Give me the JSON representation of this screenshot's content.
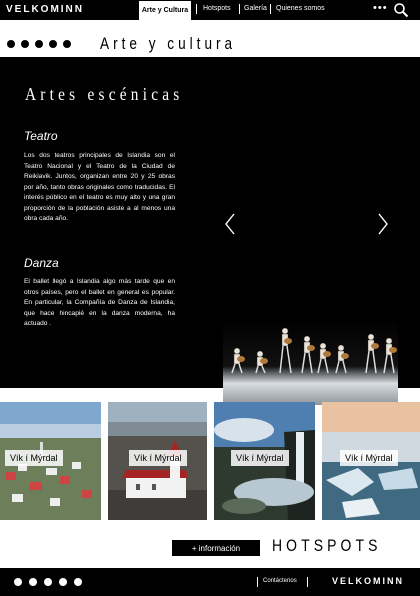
{
  "nav": {
    "brand": "VELKOMINN",
    "active_tab": "Arte y Cultura",
    "links": [
      "Hotspots",
      "Galería",
      "Quienes somos"
    ],
    "more_label": "•••"
  },
  "section": {
    "title": "Arte y cultura"
  },
  "panel": {
    "title": "Artes escénicas",
    "subsections": [
      {
        "title": "Teatro",
        "body": "Los dos teatros principales de Islandia son el Teatro Nacional y el Teatro de la Ciudad de Reikiavik. Juntos, organizan entre 20 y 25 obras por año, tanto obras originales como traducidas. El interés público en el teatro es muy alto y una gran proporción de la población asiste a al menos una obra cada año."
      },
      {
        "title": "Danza",
        "body": "El ballet llegó a Islandia algo más tarde que en otros países, pero el ballet en general es popular. En particular, la Compañía de Danza de Islandia, que hace hincapié en la danza moderna, ha actuado ."
      }
    ]
  },
  "gallery": {
    "cards": [
      {
        "label": "Vík í Mýrdal"
      },
      {
        "label": "Vík í Mýrdal"
      },
      {
        "label": "Vík í Mýrdal"
      },
      {
        "label": "Vík í Mýrdal"
      }
    ]
  },
  "cta": {
    "label": "+ información"
  },
  "hotspots": {
    "title": "HOTSPOTS"
  },
  "footer": {
    "link": "Contáctenos",
    "brand": "VELKOMINN"
  }
}
